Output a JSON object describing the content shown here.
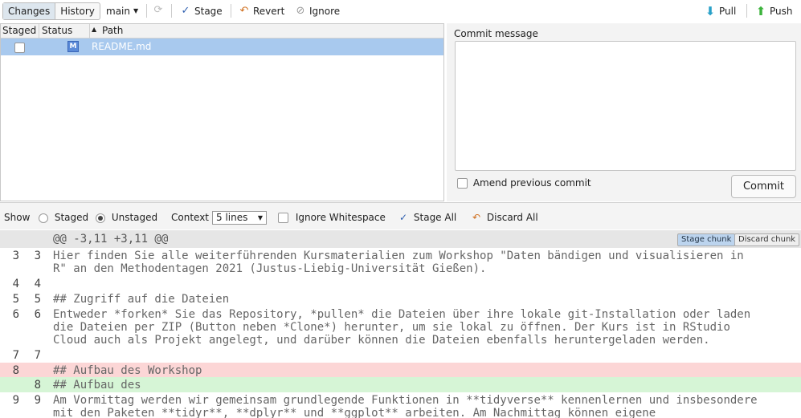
{
  "toolbar": {
    "tab_changes": "Changes",
    "tab_history": "History",
    "branch": "main",
    "stage": "Stage",
    "revert": "Revert",
    "ignore": "Ignore",
    "pull": "Pull",
    "push": "Push"
  },
  "files": {
    "columns": [
      "Staged",
      "Status",
      "Path"
    ],
    "rows": [
      {
        "staged": false,
        "status": "M",
        "path": "README.md"
      }
    ]
  },
  "commit": {
    "label": "Commit message",
    "message": "",
    "amend_label": "Amend previous commit",
    "button": "Commit"
  },
  "diff_toolbar": {
    "show_label": "Show",
    "staged": "Staged",
    "unstaged": "Unstaged",
    "context_label": "Context",
    "context_value": "5 lines",
    "ignore_ws": "Ignore Whitespace",
    "stage_all": "Stage All",
    "discard_all": "Discard All"
  },
  "diff": {
    "hunk_header": "@@ -3,11 +3,11 @@",
    "stage_chunk": "Stage chunk",
    "discard_chunk": "Discard chunk",
    "lines": [
      {
        "old": "3",
        "new": "3",
        "type": "context",
        "text": [
          "Hier finden Sie alle weiterführenden Kursmaterialien zum Workshop \"Daten bändigen und visualisieren in",
          "R\" an den Methodentagen 2021 (Justus-Liebig-Universität Gießen)."
        ]
      },
      {
        "old": "4",
        "new": "4",
        "type": "context",
        "text": [
          ""
        ]
      },
      {
        "old": "5",
        "new": "5",
        "type": "context",
        "text": [
          "## Zugriff auf die Dateien"
        ]
      },
      {
        "old": "6",
        "new": "6",
        "type": "context",
        "text": [
          "Entweder *forken* Sie das Repository, *pullen* die Dateien über ihre lokale git-Installation oder laden",
          "die Dateien per ZIP (Button neben *Clone*) herunter, um sie lokal zu öffnen. Der Kurs ist in RStudio",
          "Cloud auch als Projekt angelegt, und darüber können die Dateien ebenfalls heruntergeladen werden."
        ]
      },
      {
        "old": "7",
        "new": "7",
        "type": "context",
        "text": [
          ""
        ]
      },
      {
        "old": "8",
        "new": "",
        "type": "removed",
        "text": [
          "## Aufbau des Workshop"
        ]
      },
      {
        "old": "",
        "new": "8",
        "type": "added",
        "text": [
          "## Aufbau des"
        ]
      },
      {
        "old": "9",
        "new": "9",
        "type": "context",
        "text": [
          "Am Vormittag werden wir gemeinsam grundlegende Funktionen in **tidyverse** kennenlernen und insbesondere",
          "mit den Paketen **tidyr**, **dplyr** und **ggplot** arbeiten. Am Nachmittag können eigene"
        ]
      }
    ]
  },
  "colors": {
    "selected_row": "#a8c9ee",
    "removed_bg": "#fcd6d6",
    "added_bg": "#d6f5d6",
    "stage_chunk_bg": "#bcd4ee",
    "pull_icon": "#27a0c8",
    "push_icon": "#3cb33c"
  }
}
